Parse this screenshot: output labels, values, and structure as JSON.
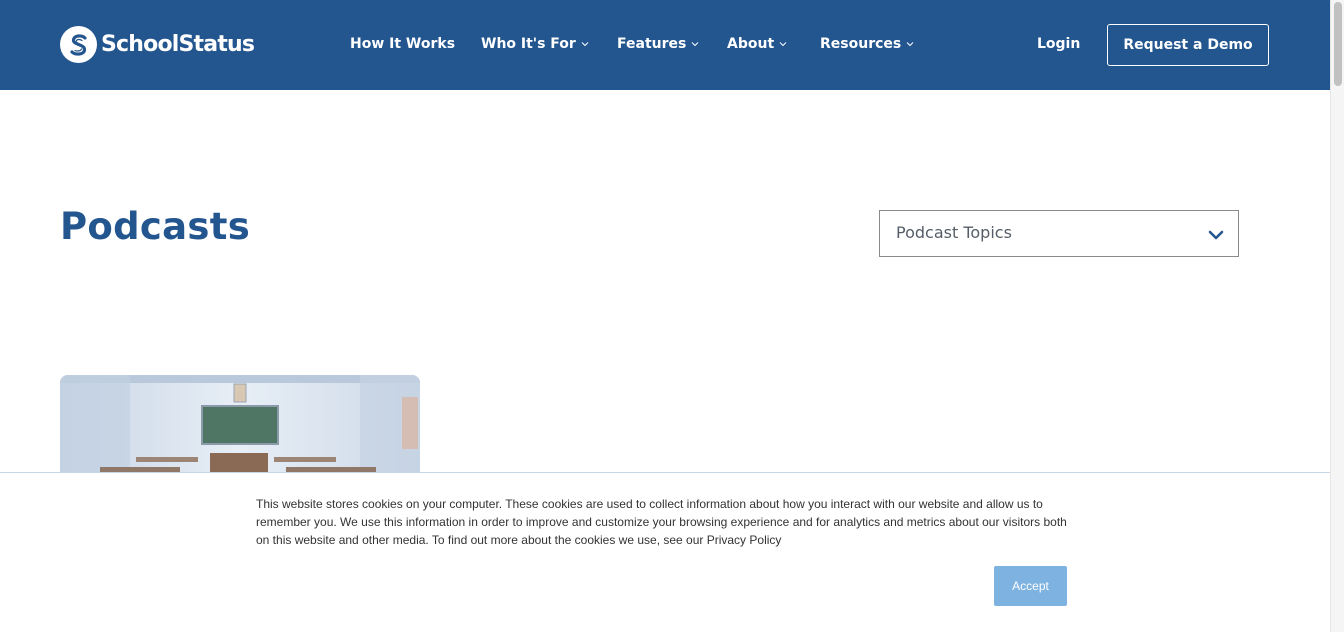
{
  "header": {
    "brand": "SchoolStatus",
    "nav": [
      {
        "label": "How It Works",
        "has_dropdown": false
      },
      {
        "label": "Who It's For",
        "has_dropdown": true
      },
      {
        "label": "Features",
        "has_dropdown": true
      },
      {
        "label": "About",
        "has_dropdown": true
      },
      {
        "label": "Resources",
        "has_dropdown": true
      }
    ],
    "login_label": "Login",
    "demo_label": "Request a Demo"
  },
  "main": {
    "title": "Podcasts",
    "topics_select": {
      "selected": "Podcast Topics"
    }
  },
  "cookie_banner": {
    "text": "This website stores cookies on your computer. These cookies are used to collect information about how you interact with our website and allow us to remember you. We use this information in order to improve and customize your browsing experience and for analytics and metrics about our visitors both on this website and other media. To find out more about the cookies we use, see our Privacy Policy",
    "accept_label": "Accept"
  },
  "colors": {
    "brand_blue": "#23558f",
    "accept_button": "#7eb2e0"
  },
  "icons": [
    "schoolstatus-logo-icon",
    "chevron-down-icon",
    "classroom-image"
  ]
}
